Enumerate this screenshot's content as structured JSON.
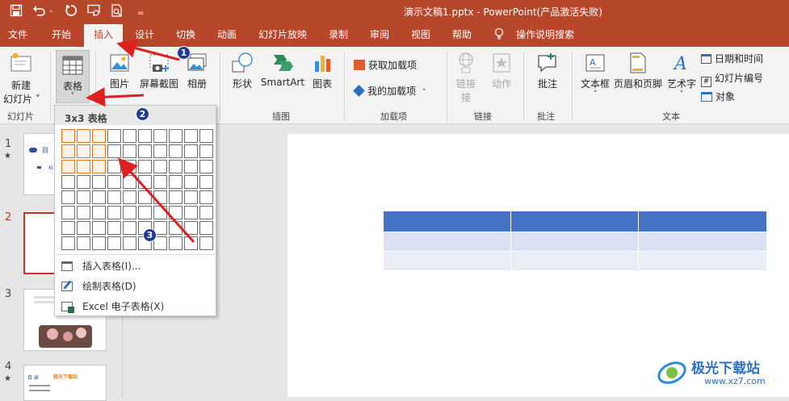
{
  "titlebar": {
    "doc_title": "演示文稿1.pptx  -  PowerPoint(产品激活失败)",
    "quick_access": [
      "save-icon",
      "undo-icon",
      "redo-icon",
      "present-icon",
      "print-preview-icon",
      "customize-icon"
    ]
  },
  "tabs": [
    {
      "label": "文件"
    },
    {
      "label": "开始"
    },
    {
      "label": "插入"
    },
    {
      "label": "设计"
    },
    {
      "label": "切换"
    },
    {
      "label": "动画"
    },
    {
      "label": "幻灯片放映"
    },
    {
      "label": "录制"
    },
    {
      "label": "审阅"
    },
    {
      "label": "视图"
    },
    {
      "label": "帮助"
    },
    {
      "label": "操作说明搜索"
    }
  ],
  "ribbon": {
    "new_slide": "新建\n幻灯片",
    "new_slide_line1": "新建",
    "new_slide_line2": "幻灯片 ˅",
    "table": "表格",
    "table_caret": "˅",
    "picture": "图片",
    "screenshot": "屏幕截图",
    "album": "相册",
    "shapes": "形状",
    "smartart": "SmartArt",
    "chart": "图表",
    "get_addins": "获取加载项",
    "my_addins": "我的加载项",
    "link": "链接",
    "link_sub": "接",
    "action": "动作",
    "comment": "批注",
    "textbox": "文本框",
    "header_footer": "页眉和页脚",
    "wordart": "艺术字",
    "date_time": "日期和时间",
    "slide_number": "幻灯片编号",
    "object": "对象",
    "groups": {
      "slides": "幻灯片",
      "illustrations": "插图",
      "addins": "加载项",
      "links": "链接",
      "comments": "批注",
      "text": "文本"
    }
  },
  "table_dropdown": {
    "title": "3x3 表格",
    "grid_cols": 10,
    "grid_rows": 8,
    "selected_cols": 3,
    "selected_rows": 3,
    "items": [
      {
        "label": "插入表格(I)..."
      },
      {
        "label": "绘制表格(D)"
      },
      {
        "label": "Excel 电子表格(X)"
      }
    ]
  },
  "slides_pane": {
    "numbers": [
      "1",
      "2",
      "3",
      "4"
    ],
    "thumb1_text": [
      "目",
      "标"
    ],
    "thumb4_title": "极光下载站",
    "thumb4_sub": "目 录"
  },
  "annotations": [
    "1",
    "2",
    "3"
  ],
  "watermark": {
    "line1": "极光下载站",
    "line2": "www.xz7.com"
  },
  "colors": {
    "accent": "#b7472a",
    "table_header": "#4472c4",
    "table_row_light": "#d9e1f2",
    "table_row_lighter": "#e9edf6",
    "grid_selected": "#e5741f",
    "arrow": "#e02020"
  }
}
